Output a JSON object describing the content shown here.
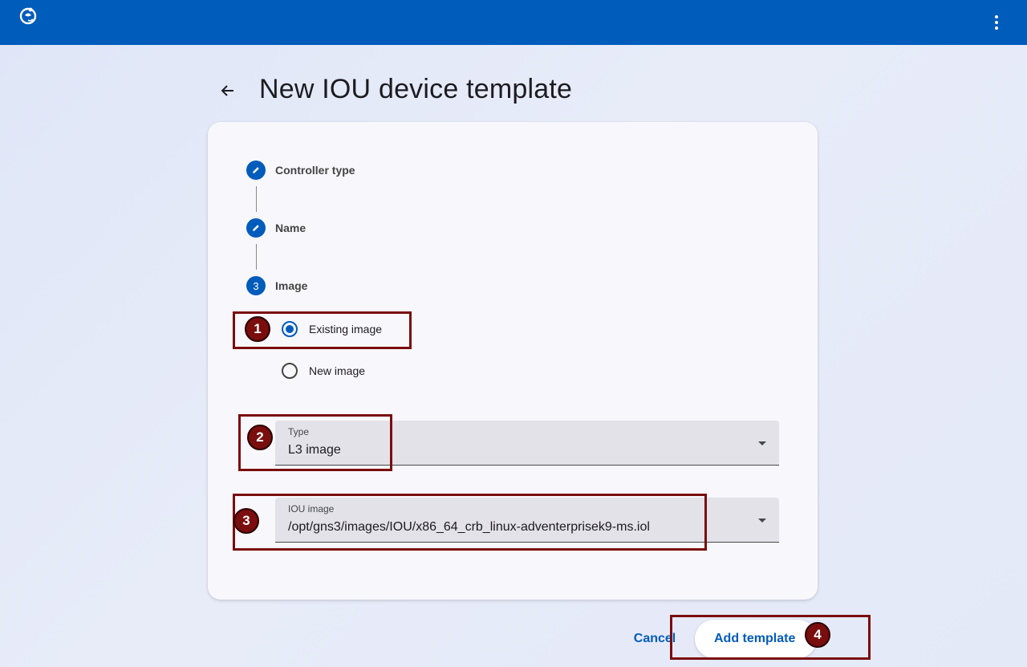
{
  "page": {
    "title": "New IOU device template"
  },
  "stepper": {
    "steps": [
      {
        "label": "Controller type",
        "state": "edit",
        "icon": "pencil-icon"
      },
      {
        "label": "Name",
        "state": "edit",
        "icon": "pencil-icon"
      },
      {
        "label": "Image",
        "state": "active",
        "number": "3"
      }
    ]
  },
  "image_source": {
    "options": [
      {
        "label": "Existing image",
        "selected": true
      },
      {
        "label": "New image",
        "selected": false
      }
    ]
  },
  "type_field": {
    "label": "Type",
    "value": "L3 image"
  },
  "iou_image_field": {
    "label": "IOU image",
    "value": "/opt/gns3/images/IOU/x86_64_crb_linux-adventerprisek9-ms.iol"
  },
  "actions": {
    "cancel": "Cancel",
    "add": "Add template"
  },
  "annotations": {
    "badges": [
      "1",
      "2",
      "3",
      "4"
    ],
    "color": "#7a0d0d"
  },
  "colors": {
    "primary": "#005cbb",
    "topbar": "#005cbb"
  }
}
